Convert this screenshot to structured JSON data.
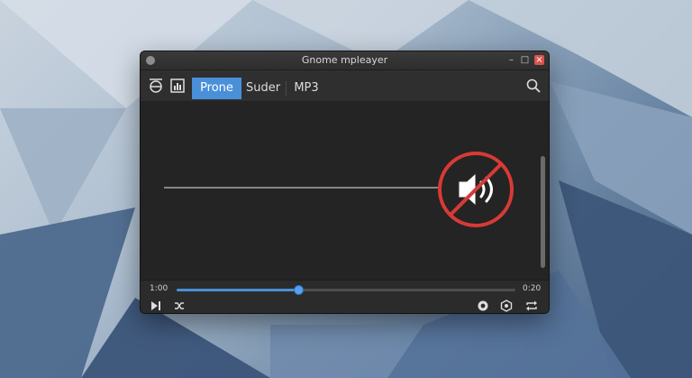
{
  "window": {
    "title": "Gnome mpleayer"
  },
  "toolbar": {
    "tabs": [
      {
        "label": "Prone",
        "active": true
      },
      {
        "label": "Suder",
        "active": false
      },
      {
        "label": "MP3",
        "active": false
      }
    ]
  },
  "visualizer": {
    "overlay_icon": "muted-speaker-prohibited-icon"
  },
  "playback": {
    "current_time": "1:00",
    "total_time": "0:20",
    "progress_fraction": 0.36
  },
  "colors": {
    "accent": "#4a90d9",
    "prohibit_red": "#d83a36",
    "waveform_white": "#e8e8e8",
    "waveform_blue": "#7fb3e6"
  },
  "icons": {
    "toolbar_left": [
      "collapse-arrows-icon",
      "chart-icon"
    ],
    "toolbar_right": [
      "search-icon"
    ],
    "controls_left": [
      "skip-next-icon",
      "shuffle-icon"
    ],
    "controls_right": [
      "record-icon",
      "settings-icon",
      "repeat-icon"
    ]
  }
}
